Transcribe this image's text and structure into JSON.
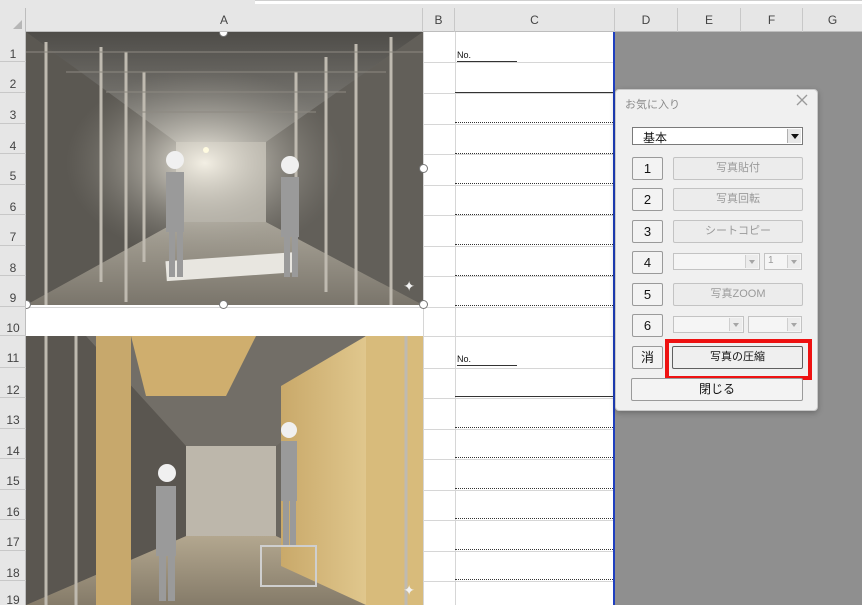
{
  "columns": [
    "A",
    "B",
    "C",
    "D",
    "E",
    "F",
    "G"
  ],
  "rows": [
    "1",
    "2",
    "3",
    "4",
    "5",
    "6",
    "7",
    "8",
    "9",
    "10",
    "11",
    "12",
    "13",
    "14",
    "15",
    "16",
    "17",
    "18",
    "19"
  ],
  "sheet": {
    "no_label": "No.",
    "photos": [
      {
        "name": "construction-photo-steel-frame",
        "desc_icon": "sparkle-icon"
      },
      {
        "name": "construction-photo-drywall",
        "desc_icon": "sparkle-icon"
      }
    ],
    "colors": {
      "print_border": "#1f3fbf",
      "gray_area": "#8f8f8f"
    }
  },
  "dialog": {
    "title": "お気に入り",
    "select_value": "基本",
    "buttons": [
      {
        "num": "1",
        "label": "写真貼付",
        "enabled": false
      },
      {
        "num": "2",
        "label": "写真回転",
        "enabled": false
      },
      {
        "num": "3",
        "label": "シートコピー",
        "enabled": false
      },
      {
        "num": "4",
        "label": "",
        "mini1": "",
        "mini2": "1"
      },
      {
        "num": "5",
        "label": "写真ZOOM",
        "enabled": false
      },
      {
        "num": "6",
        "label": "",
        "mini1": "",
        "mini2": ""
      },
      {
        "num": "消",
        "label": "写真の圧縮",
        "enabled": true
      }
    ],
    "close_label": "閉じる",
    "highlight_color": "#ee1111"
  }
}
